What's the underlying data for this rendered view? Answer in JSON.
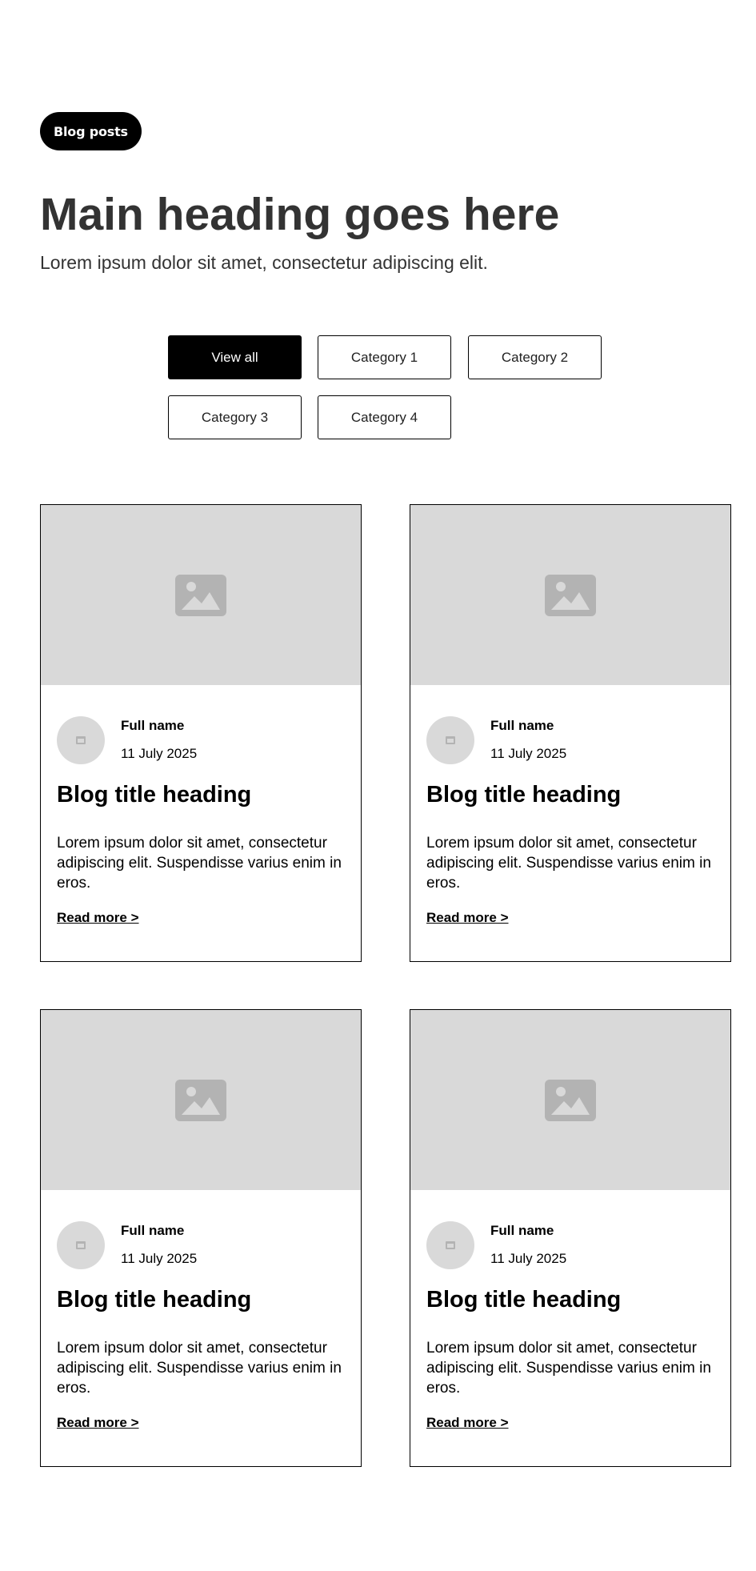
{
  "header": {
    "badge": "Blog posts",
    "title": "Main heading goes here",
    "subtitle": "Lorem ipsum dolor sit amet, consectetur adipiscing elit."
  },
  "filters": [
    {
      "label": "View all",
      "active": true
    },
    {
      "label": "Category 1",
      "active": false
    },
    {
      "label": "Category 2",
      "active": false
    },
    {
      "label": "Category 3",
      "active": false
    },
    {
      "label": "Category 4",
      "active": false
    }
  ],
  "posts": [
    {
      "image_icon": "image-placeholder-icon",
      "author": "Full name",
      "date": "11 July 2025",
      "title": "Blog title heading",
      "excerpt": "Lorem ipsum dolor sit amet, consectetur adipiscing elit. Suspendisse varius enim in eros.",
      "link_label": "Read more >"
    },
    {
      "image_icon": "image-placeholder-icon",
      "author": "Full name",
      "date": "11 July 2025",
      "title": "Blog title heading",
      "excerpt": "Lorem ipsum dolor sit amet, consectetur adipiscing elit. Suspendisse varius enim in eros.",
      "link_label": "Read more >"
    },
    {
      "image_icon": "image-placeholder-icon",
      "author": "Full name",
      "date": "11 July 2025",
      "title": "Blog title heading",
      "excerpt": "Lorem ipsum dolor sit amet, consectetur adipiscing elit. Suspendisse varius enim in eros.",
      "link_label": "Read more >"
    },
    {
      "image_icon": "image-placeholder-icon",
      "author": "Full name",
      "date": "11 July 2025",
      "title": "Blog title heading",
      "excerpt": "Lorem ipsum dolor sit amet, consectetur adipiscing elit. Suspendisse varius enim in eros.",
      "link_label": "Read more >"
    }
  ],
  "colors": {
    "accent": "#000000",
    "heading_text": "#333333",
    "placeholder": "#d9d9d9",
    "placeholder_icon": "#b3b3b3"
  }
}
